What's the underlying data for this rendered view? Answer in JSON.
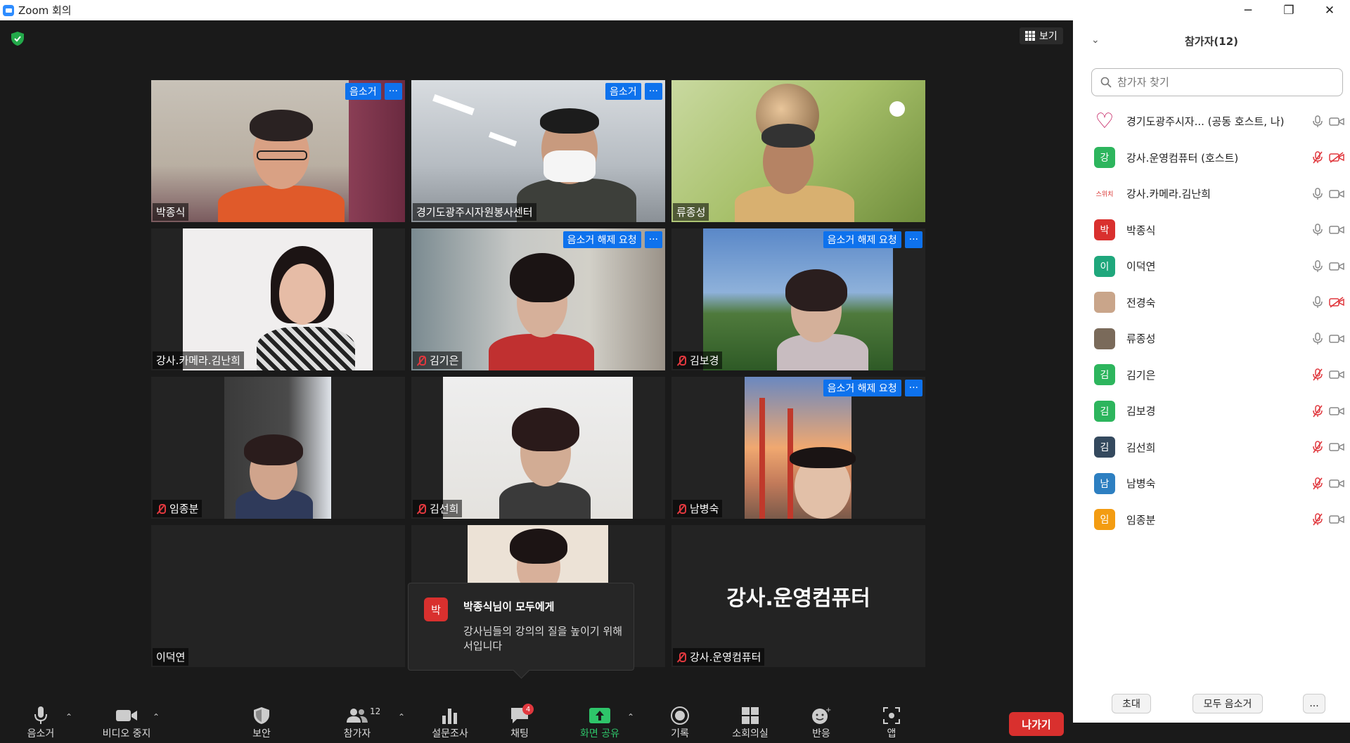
{
  "window": {
    "title": "Zoom 회의",
    "controls": [
      "minimize",
      "maximize",
      "close"
    ]
  },
  "view_label": "보기",
  "tiles": [
    {
      "name": "박종식",
      "buttons": [
        "음소거",
        "···"
      ],
      "muted": false
    },
    {
      "name": "경기도광주시자원봉사센터",
      "buttons": [
        "음소거",
        "···"
      ],
      "muted": false
    },
    {
      "name": "류종성",
      "buttons": [],
      "muted": false
    },
    {
      "name": "강사.카메라.김난희",
      "buttons": [],
      "muted": false,
      "active_speaker": true
    },
    {
      "name": "김기은",
      "buttons": [
        "음소거 해제 요청",
        "···"
      ],
      "muted": true
    },
    {
      "name": "김보경",
      "buttons": [
        "음소거 해제 요청",
        "···"
      ],
      "muted": true
    },
    {
      "name": "임종분",
      "buttons": [],
      "muted": true
    },
    {
      "name": "김선희",
      "buttons": [],
      "muted": true
    },
    {
      "name": "남병숙",
      "buttons": [
        "음소거 해제 요청",
        "···"
      ],
      "muted": true
    },
    {
      "name": "이덕연",
      "buttons": [],
      "muted": false
    },
    {
      "name": "",
      "buttons": [],
      "muted": false
    },
    {
      "name": "강사.운영컴퓨터",
      "big_name": "강사.운영컴퓨터",
      "buttons": [],
      "muted": true
    }
  ],
  "chat_toast": {
    "avatar": "박",
    "from": "박종식님이 모두에게",
    "message": "강사님들의 강의의 질을 높이기 위해서입니다"
  },
  "toolbar": {
    "mute": "음소거",
    "video": "비디오 중지",
    "security": "보안",
    "participants": "참가자",
    "participants_count": "12",
    "polls": "설문조사",
    "chat": "채팅",
    "chat_badge": "4",
    "share": "화면 공유",
    "record": "기록",
    "breakout": "소회의실",
    "reactions": "반응",
    "apps": "앱",
    "leave": "나가기"
  },
  "panel": {
    "title": "참가자(12)",
    "search_placeholder": "참가자 찾기",
    "participants": [
      {
        "avatar": "♡",
        "avatar_color": "#c2185b",
        "name": "경기도광주시자...  (공동 호스트, 나)",
        "mic": "on",
        "cam": "on"
      },
      {
        "avatar": "강",
        "avatar_color": "#2db55d",
        "name": "강사.운영컴퓨터 (호스트)",
        "mic": "off",
        "cam": "off"
      },
      {
        "avatar": "스위치",
        "avatar_color": "#ffffff",
        "name": "강사.카메라.김난희",
        "mic": "on",
        "cam": "on"
      },
      {
        "avatar": "박",
        "avatar_color": "#d9302e",
        "name": "박종식",
        "mic": "on",
        "cam": "on"
      },
      {
        "avatar": "이",
        "avatar_color": "#1fa77c",
        "name": "이덕연",
        "mic": "on",
        "cam": "on"
      },
      {
        "avatar": "",
        "avatar_color": "#c9a58a",
        "name": "전경숙",
        "mic": "on",
        "cam": "off"
      },
      {
        "avatar": "",
        "avatar_color": "#7a6a5a",
        "name": "류종성",
        "mic": "on",
        "cam": "on"
      },
      {
        "avatar": "김",
        "avatar_color": "#2db55d",
        "name": "김기은",
        "mic": "off",
        "cam": "on"
      },
      {
        "avatar": "김",
        "avatar_color": "#2db55d",
        "name": "김보경",
        "mic": "off",
        "cam": "on"
      },
      {
        "avatar": "김",
        "avatar_color": "#34495e",
        "name": "김선희",
        "mic": "off",
        "cam": "on"
      },
      {
        "avatar": "남",
        "avatar_color": "#2d7fc1",
        "name": "남병숙",
        "mic": "off",
        "cam": "on"
      },
      {
        "avatar": "임",
        "avatar_color": "#f39c12",
        "name": "임종분",
        "mic": "off",
        "cam": "on"
      }
    ],
    "invite": "초대",
    "mute_all": "모두 음소거",
    "more": "..."
  }
}
